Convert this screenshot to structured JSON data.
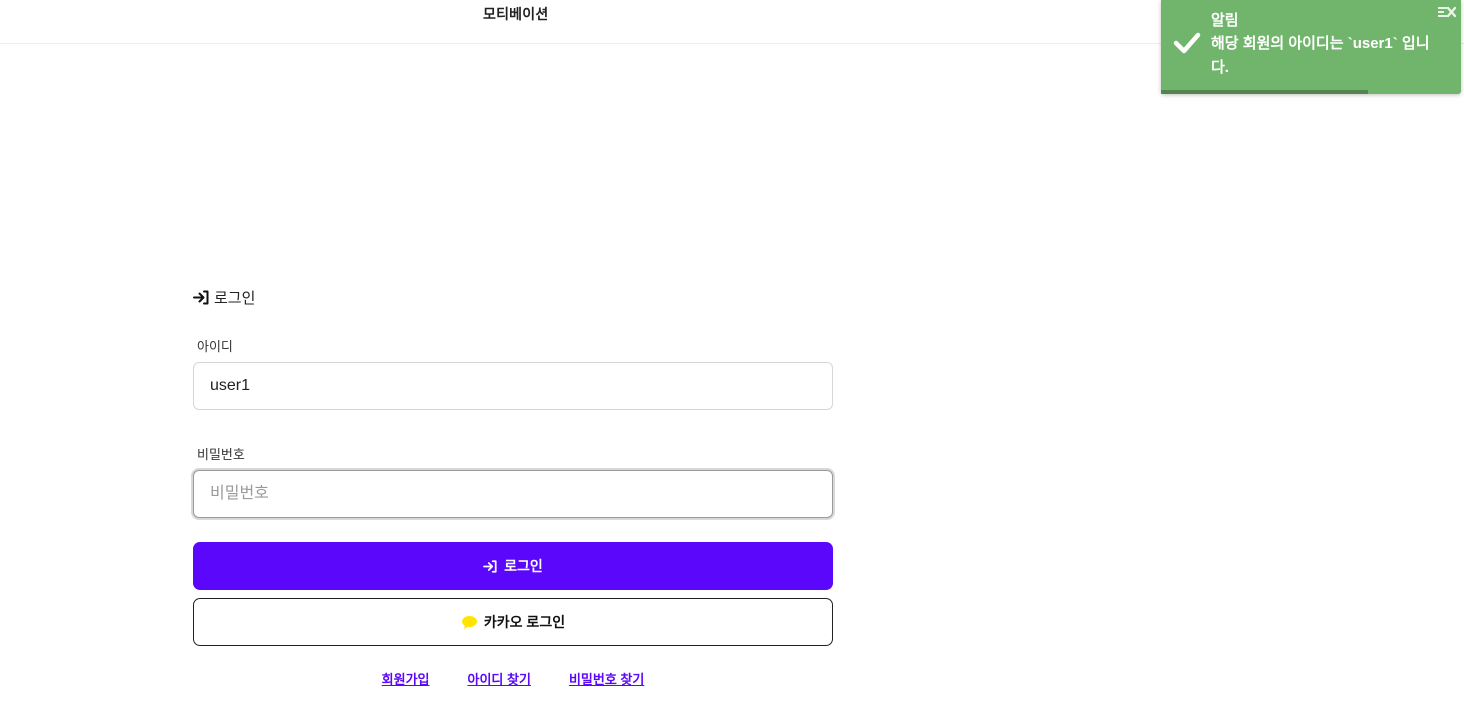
{
  "header": {
    "brand": "모티베이션"
  },
  "toast": {
    "title": "알림",
    "message": "해당 회원의 아이디는 `user1` 입니다.",
    "progress": 0.69,
    "color": "#71b56d"
  },
  "login": {
    "title": "로그인",
    "id_label": "아이디",
    "id_value": "user1",
    "password_label": "비밀번호",
    "password_placeholder": "비밀번호",
    "login_button": "로그인",
    "kakao_button": "카카오 로그인",
    "accent_color": "#5b07fb",
    "kakao_icon_color": "#ffe500"
  },
  "links": [
    "회원가입",
    "아이디 찾기",
    "비밀번호 찾기"
  ],
  "icons": {
    "title": "sign-in-icon",
    "toast": "check-icon",
    "close": "close-icon",
    "kakao": "chat-bubble-icon"
  }
}
